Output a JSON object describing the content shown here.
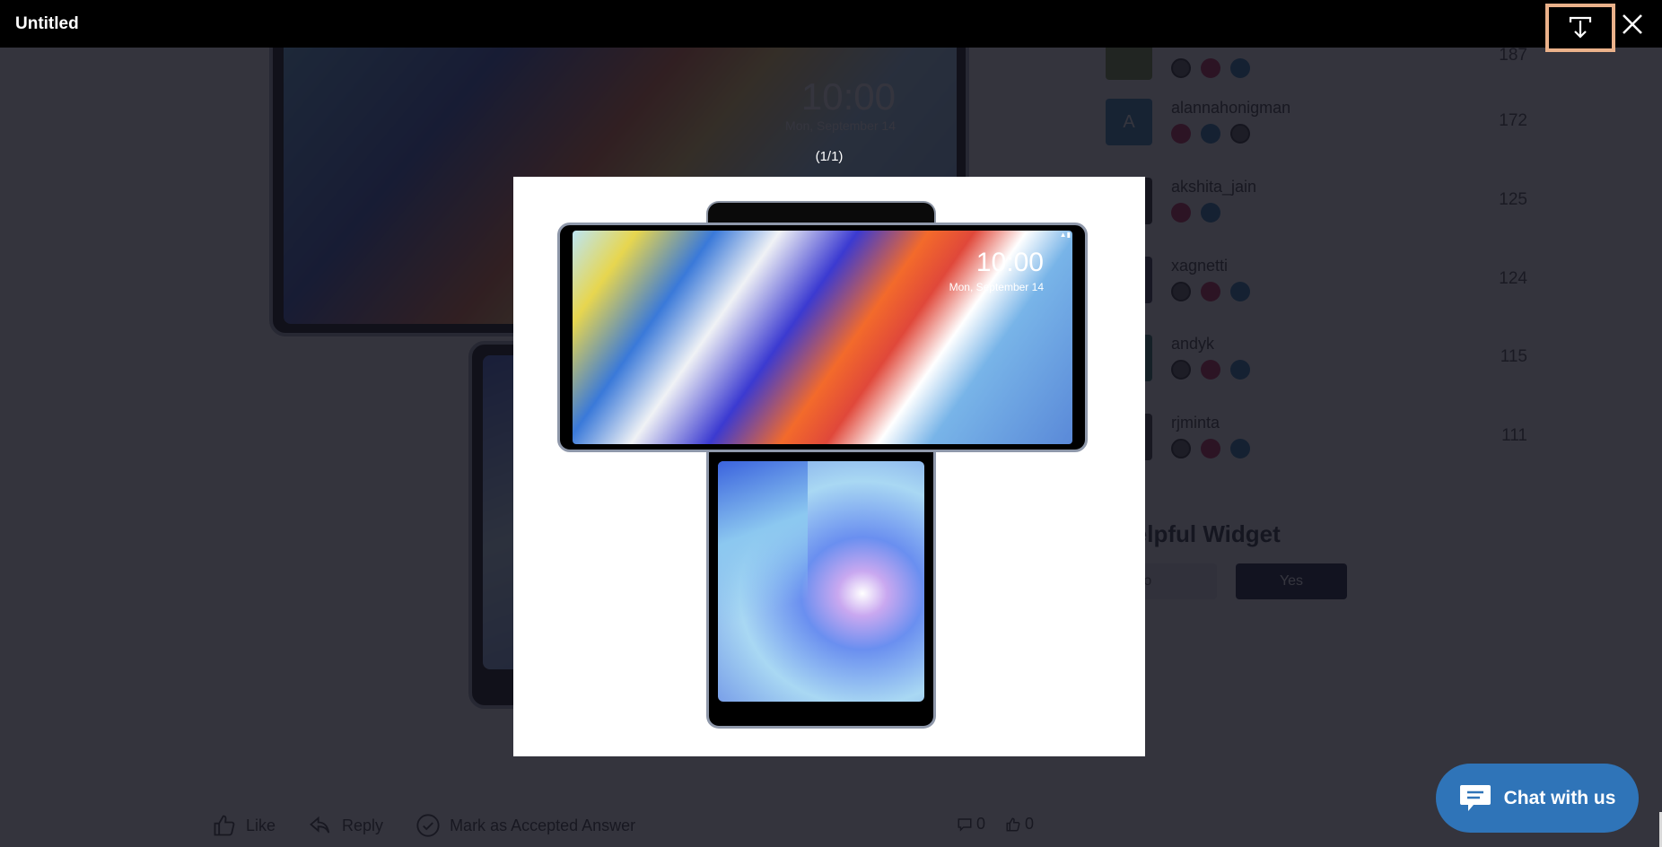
{
  "viewer": {
    "title": "Untitled",
    "counter": "(1/1)",
    "download_icon": "download-icon",
    "close_icon": "close-icon",
    "highlight_color": "#eab18a",
    "image": {
      "description": "LG Wing dual-screen phone in swivel mode",
      "main_screen_clock": "10:00",
      "main_screen_date": "Mon, September 14"
    }
  },
  "background_page": {
    "post_image": {
      "clock": "10:00",
      "date": "Mon, September 14"
    },
    "leaderboard": [
      {
        "avatar": "",
        "name": "",
        "value": "187",
        "badges": [
          "gray",
          "red",
          "blue"
        ]
      },
      {
        "avatar": "A",
        "name": "alannahonigman",
        "value": "172",
        "badges": [
          "red",
          "blue",
          "gray"
        ]
      },
      {
        "avatar": "",
        "name": "akshita_jain",
        "value": "125",
        "badges": [
          "red",
          "blue"
        ]
      },
      {
        "avatar": "",
        "name": "xagnetti",
        "value": "124",
        "badges": [
          "gray",
          "red",
          "blue"
        ]
      },
      {
        "avatar": "",
        "name": "andyk",
        "value": "115",
        "badges": [
          "gray",
          "red",
          "blue"
        ]
      },
      {
        "avatar": "",
        "name": "rjminta",
        "value": "111",
        "badges": [
          "gray",
          "red",
          "blue"
        ]
      }
    ],
    "helpful_widget": {
      "title": "Helpful Widget",
      "no_label": "No",
      "yes_label": "Yes"
    },
    "actions": {
      "like": "Like",
      "reply": "Reply",
      "accept": "Mark as Accepted Answer",
      "comment_count": "0",
      "like_count": "0"
    }
  },
  "chat": {
    "label": "Chat with us",
    "color": "#2f74b8"
  }
}
